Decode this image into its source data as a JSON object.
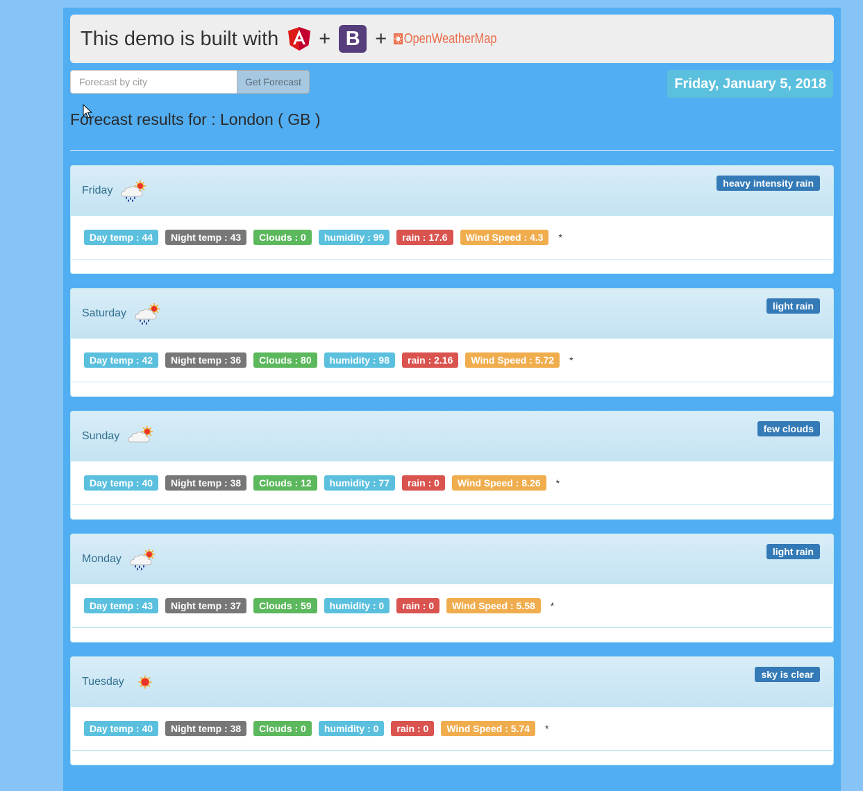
{
  "header": {
    "title": "This demo is built with",
    "plus": "+",
    "bootstrap_letter": "B",
    "owm_text": "OpenWeatherMap"
  },
  "search": {
    "placeholder": "Forecast by city",
    "button_label": "Get Forecast"
  },
  "date": "Friday, January 5, 2018",
  "results_title": "Forecast results for : London ( GB )",
  "labels": {
    "day_temp": "Day temp : ",
    "night_temp": "Night temp : ",
    "clouds": "Clouds : ",
    "humidity": "humidity : ",
    "rain": "rain : ",
    "wind": "Wind Speed : ",
    "star": "*"
  },
  "forecast": [
    {
      "day": "Friday",
      "icon": "rain-cloud-sun-icon",
      "desc": "heavy intensity rain",
      "day_temp": "Day temp : 44",
      "night_temp": "Night temp : 43",
      "clouds": "Clouds : 0",
      "humidity": "humidity : 99",
      "rain": "rain : 17.6",
      "wind": "Wind Speed : 4.3"
    },
    {
      "day": "Saturday",
      "icon": "rain-cloud-sun-icon",
      "desc": "light rain",
      "day_temp": "Day temp : 42",
      "night_temp": "Night temp : 36",
      "clouds": "Clouds : 80",
      "humidity": "humidity : 98",
      "rain": "rain : 2.16",
      "wind": "Wind Speed : 5.72"
    },
    {
      "day": "Sunday",
      "icon": "cloud-sun-icon",
      "desc": "few clouds",
      "day_temp": "Day temp : 40",
      "night_temp": "Night temp : 38",
      "clouds": "Clouds : 12",
      "humidity": "humidity : 77",
      "rain": "rain : 0",
      "wind": "Wind Speed : 8.26"
    },
    {
      "day": "Monday",
      "icon": "rain-cloud-sun-icon",
      "desc": "light rain",
      "day_temp": "Day temp : 43",
      "night_temp": "Night temp : 37",
      "clouds": "Clouds : 59",
      "humidity": "humidity : 0",
      "rain": "rain : 0",
      "wind": "Wind Speed : 5.58"
    },
    {
      "day": "Tuesday",
      "icon": "sun-icon",
      "desc": "sky is clear",
      "day_temp": "Day temp : 40",
      "night_temp": "Night temp : 38",
      "clouds": "Clouds : 0",
      "humidity": "humidity : 0",
      "rain": "rain : 0",
      "wind": "Wind Speed : 5.74"
    }
  ],
  "colors": {
    "page_bg": "#86c3f6",
    "container_bg": "#52aef2",
    "primary": "#337ab7",
    "info": "#5bc0de",
    "default": "#777777",
    "success": "#5cb85c",
    "danger": "#d9534f",
    "warning": "#f0ad4e"
  }
}
